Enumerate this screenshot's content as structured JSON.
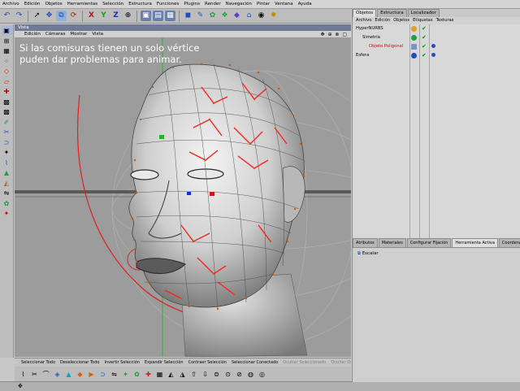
{
  "menubar": [
    "Archivo",
    "Edición",
    "Objetos",
    "Herramientas",
    "Selección",
    "Estructura",
    "Funciones",
    "Plugins",
    "Render",
    "Navegación",
    "Pintar",
    "Ventana",
    "Ayuda"
  ],
  "viewport": {
    "title": "Vista",
    "menu": [
      "Edición",
      "Cámaras",
      "Mostrar",
      "Vista"
    ],
    "nav_icons": "✥ ⊕ ⊗ ▢",
    "overlay_line1": "Si las comisuras tienen un solo vértice",
    "overlay_line2": "puden dar problemas para animar."
  },
  "object_manager": {
    "tabs": [
      "Objetos",
      "Estructura",
      "Localizador"
    ],
    "active_tab": "Objetos",
    "menu": [
      "Archivo",
      "Edición",
      "Objetos",
      "Etiquetas",
      "Texturas"
    ],
    "objects": [
      {
        "name": "HyperNURBS",
        "indent": 0,
        "selected": false
      },
      {
        "name": "Simetría",
        "indent": 1,
        "selected": false
      },
      {
        "name": "Objeto Poligonal",
        "indent": 2,
        "selected": true
      },
      {
        "name": "Esfera",
        "indent": 0,
        "selected": false
      }
    ]
  },
  "attribute_manager": {
    "tabs": [
      "Atributos",
      "Materiales",
      "Configurar Fijación",
      "Herramienta Activa",
      "Coordenadas"
    ],
    "active_tab": "Herramienta Activa",
    "tool_name": "Escalar"
  },
  "command_bar": {
    "buttons": [
      "Seleccionar Todo",
      "Deseleccionar Todo",
      "Invertir Selección",
      "Expandir Selección",
      "Contraer Selección",
      "Seleccionar Conectado"
    ],
    "disabled_buttons": [
      "Ocultar Seleccionado",
      "Ocultar Dese"
    ]
  },
  "colors": {
    "accent_title": "#6f7a99",
    "selected_object": "#d01010",
    "viewport_bg": "#9c9c9c",
    "edge_highlight": "#ff2020"
  }
}
